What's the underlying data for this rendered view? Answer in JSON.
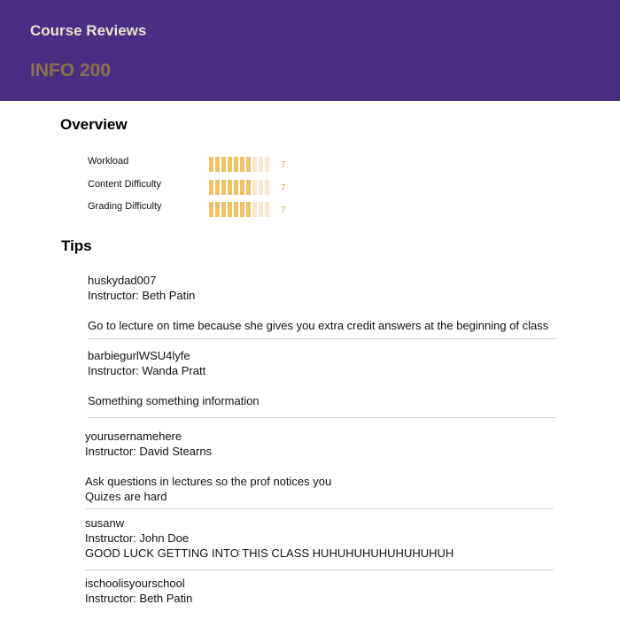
{
  "header": {
    "app_title": "Course Reviews",
    "course_code": "INFO 200"
  },
  "overview": {
    "title": "Overview",
    "metrics": [
      {
        "label": "Workload",
        "value": 7,
        "max": 10,
        "value_text": "7"
      },
      {
        "label": "Content Difficulty",
        "value": 7,
        "max": 10,
        "value_text": "7"
      },
      {
        "label": "Grading Difficulty",
        "value": 7,
        "max": 10,
        "value_text": "7"
      }
    ]
  },
  "tips": {
    "title": "Tips",
    "items": [
      {
        "username": "huskydad007",
        "instructor": "Instructor: Beth Patin",
        "lines": [
          "Go to lecture on time because she gives you extra credit answers at the beginning of class"
        ]
      },
      {
        "username": "barbiegurlWSU4lyfe",
        "instructor": "Instructor: Wanda Pratt",
        "lines": [
          "Something something information"
        ]
      },
      {
        "username": "yourusernamehere",
        "instructor": "Instructor: David Stearns",
        "lines": [
          "Ask questions in lectures so the prof notices you",
          "Quizes are hard"
        ]
      },
      {
        "username": "susanw",
        "instructor": "Instructor: John Doe",
        "lines": [
          "GOOD LUCK GETTING INTO THIS CLASS HUHUHUHUHUHUHUHUH"
        ]
      },
      {
        "username": "ischoolisyourschool",
        "instructor": "Instructor: Beth Patin",
        "lines": []
      }
    ]
  },
  "colors": {
    "header_bg": "#4b2e83",
    "title_text": "#e8e3d3",
    "course_code": "#85754d",
    "bar_filled": "#f3c163",
    "bar_empty": "#fbe6cf",
    "score_text": "#e8a04a"
  }
}
